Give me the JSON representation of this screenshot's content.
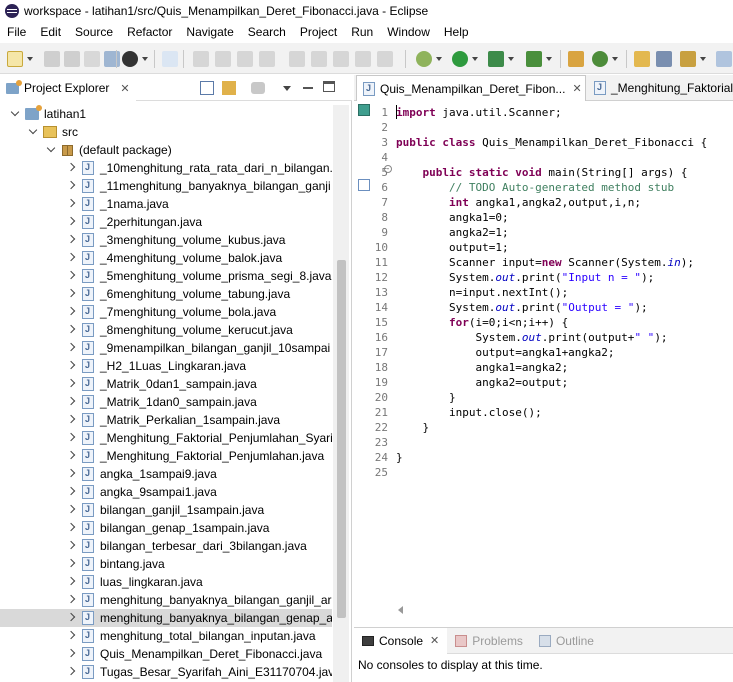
{
  "window": {
    "title": "workspace - latihan1/src/Quis_Menampilkan_Deret_Fibonacci.java - Eclipse"
  },
  "menu": [
    "File",
    "Edit",
    "Source",
    "Refactor",
    "Navigate",
    "Search",
    "Project",
    "Run",
    "Window",
    "Help"
  ],
  "explorer": {
    "tab_label": "Project Explorer",
    "project": "latihan1",
    "src": "src",
    "package": "(default package)",
    "files": [
      "_10menghitung_rata_rata_dari_n_bilangan.j",
      "_11menghitung_banyaknya_bilangan_ganji",
      "_1nama.java",
      "_2perhitungan.java",
      "_3menghitung_volume_kubus.java",
      "_4menghitung_volume_balok.java",
      "_5menghitung_volume_prisma_segi_8.java",
      "_6menghitung_volume_tabung.java",
      "_7menghitung_volume_bola.java",
      "_8menghitung_volume_kerucut.java",
      "_9menampilkan_bilangan_ganjil_10sampai",
      "_H2_1Luas_Lingkaran.java",
      "_Matrik_0dan1_sampain.java",
      "_Matrik_1dan0_sampain.java",
      "_Matrik_Perkalian_1sampain.java",
      "_Menghitung_Faktorial_Penjumlahan_Syari",
      "_Menghitung_Faktorial_Penjumlahan.java",
      "angka_1sampai9.java",
      "angka_9sampai1.java",
      "bilangan_ganjil_1sampain.java",
      "bilangan_genap_1sampain.java",
      "bilangan_terbesar_dari_3bilangan.java",
      "bintang.java",
      "luas_lingkaran.java",
      "menghitung_banyaknya_bilangan_ganjil_ar",
      "menghitung_banyaknya_bilangan_genap_a",
      "menghitung_total_bilangan_inputan.java",
      "Quis_Menampilkan_Deret_Fibonacci.java",
      "Tugas_Besar_Syarifah_Aini_E31170704.java"
    ],
    "selected_index": 25
  },
  "editor": {
    "tabs": [
      "Quis_Menampilkan_Deret_Fibon...",
      "_Menghitung_Faktorial_"
    ],
    "line_numbers": [
      "1",
      "2",
      "3",
      "4",
      "5",
      "6",
      "7",
      "8",
      "9",
      "10",
      "11",
      "12",
      "13",
      "14",
      "15",
      "16",
      "17",
      "18",
      "19",
      "20",
      "21",
      "22",
      "23",
      "24",
      "25"
    ],
    "lines": [
      [
        {
          "t": "import",
          "c": "kw"
        },
        {
          "t": " java.util.Scanner;"
        }
      ],
      [],
      [
        {
          "t": "public",
          "c": "kw"
        },
        {
          "t": " "
        },
        {
          "t": "class",
          "c": "kw"
        },
        {
          "t": " Quis_Menampilkan_Deret_Fibonacci {"
        }
      ],
      [],
      [
        {
          "t": "    "
        },
        {
          "t": "public",
          "c": "kw"
        },
        {
          "t": " "
        },
        {
          "t": "static",
          "c": "kw"
        },
        {
          "t": " "
        },
        {
          "t": "void",
          "c": "kw"
        },
        {
          "t": " main(String[] args) {"
        }
      ],
      [
        {
          "t": "        "
        },
        {
          "t": "// TODO Auto-generated method stub",
          "c": "cm"
        }
      ],
      [
        {
          "t": "        "
        },
        {
          "t": "int",
          "c": "kw"
        },
        {
          "t": " angka1,angka2,output,i,n;"
        }
      ],
      [
        {
          "t": "        angka1=0;"
        }
      ],
      [
        {
          "t": "        angka2=1;"
        }
      ],
      [
        {
          "t": "        output=1;"
        }
      ],
      [
        {
          "t": "        Scanner input="
        },
        {
          "t": "new",
          "c": "kw"
        },
        {
          "t": " Scanner(System."
        },
        {
          "t": "in",
          "c": "fi"
        },
        {
          "t": ");"
        }
      ],
      [
        {
          "t": "        System."
        },
        {
          "t": "out",
          "c": "fi"
        },
        {
          "t": ".print("
        },
        {
          "t": "\"Input n = \"",
          "c": "st"
        },
        {
          "t": ");"
        }
      ],
      [
        {
          "t": "        n=input.nextInt();"
        }
      ],
      [
        {
          "t": "        System."
        },
        {
          "t": "out",
          "c": "fi"
        },
        {
          "t": ".print("
        },
        {
          "t": "\"Output = \"",
          "c": "st"
        },
        {
          "t": ");"
        }
      ],
      [
        {
          "t": "        "
        },
        {
          "t": "for",
          "c": "kw"
        },
        {
          "t": "(i=0;i<n;i++) {"
        }
      ],
      [
        {
          "t": "            System."
        },
        {
          "t": "out",
          "c": "fi"
        },
        {
          "t": ".print(output+"
        },
        {
          "t": "\" \"",
          "c": "st"
        },
        {
          "t": ");"
        }
      ],
      [
        {
          "t": "            output=angka1+angka2;"
        }
      ],
      [
        {
          "t": "            angka1=angka2;"
        }
      ],
      [
        {
          "t": "            angka2=output;"
        }
      ],
      [
        {
          "t": "        }"
        }
      ],
      [
        {
          "t": "        input.close();"
        }
      ],
      [
        {
          "t": "    }"
        }
      ],
      [],
      [
        {
          "t": "}"
        }
      ],
      []
    ]
  },
  "console": {
    "tabs": [
      "Console",
      "Problems",
      "Outline"
    ],
    "message": "No consoles to display at this time."
  }
}
